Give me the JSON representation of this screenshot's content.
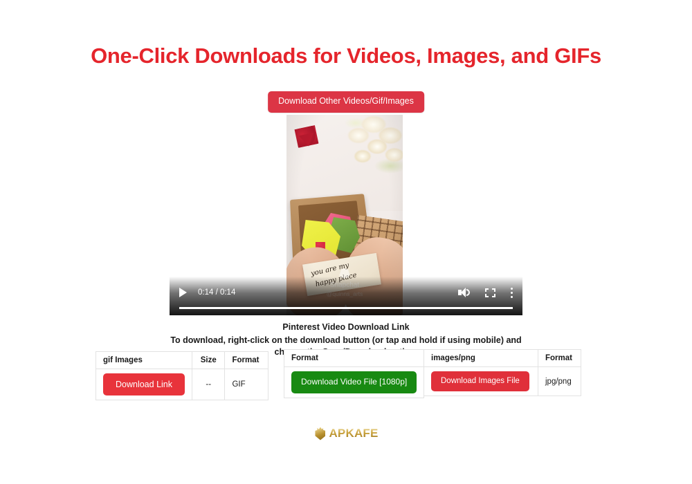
{
  "headline": "One-Click Downloads for Videos, Images, and GIFs",
  "top_cta": {
    "label": "Download Other Videos/Gif/Images"
  },
  "player": {
    "time_display": "0:14 / 0:14",
    "current_time": "0:14",
    "duration": "0:14",
    "progress_percent": 100,
    "play_icon": "play-icon",
    "volume_icon": "volume-icon",
    "fullscreen_icon": "fullscreen-icon",
    "menu_icon": "kebab-menu-icon",
    "watermark": {
      "logo_icon": "snapchat-ghost-icon",
      "name": "Snapchat",
      "handle": "@quinns_arts"
    },
    "note_line_1": "you are my",
    "note_line_2": "happy place"
  },
  "caption": {
    "title": "Pinterest Video Download Link",
    "instructions": "To download, right-click on the download button (or tap and hold if using mobile) and choose the Save/Download option."
  },
  "tables": {
    "gif": {
      "headers": [
        "gif Images",
        "Size",
        "Format"
      ],
      "rows": [
        {
          "button": "Download Link",
          "size": "--",
          "format": "GIF"
        }
      ]
    },
    "video": {
      "headers": [
        "Format"
      ],
      "rows": [
        {
          "button": "Download Video File [1080p]"
        }
      ]
    },
    "images": {
      "headers": [
        "images/png",
        "Format"
      ],
      "rows": [
        {
          "button": "Download Images File",
          "format": "jpg/png"
        }
      ]
    }
  },
  "footer": {
    "brand": "APKAFE"
  },
  "colors": {
    "brand_red": "#e5252c",
    "button_red": "#e8333b",
    "cta_red": "#dc3545",
    "button_green": "#188a12",
    "logo_gold": "#c9a23c"
  }
}
